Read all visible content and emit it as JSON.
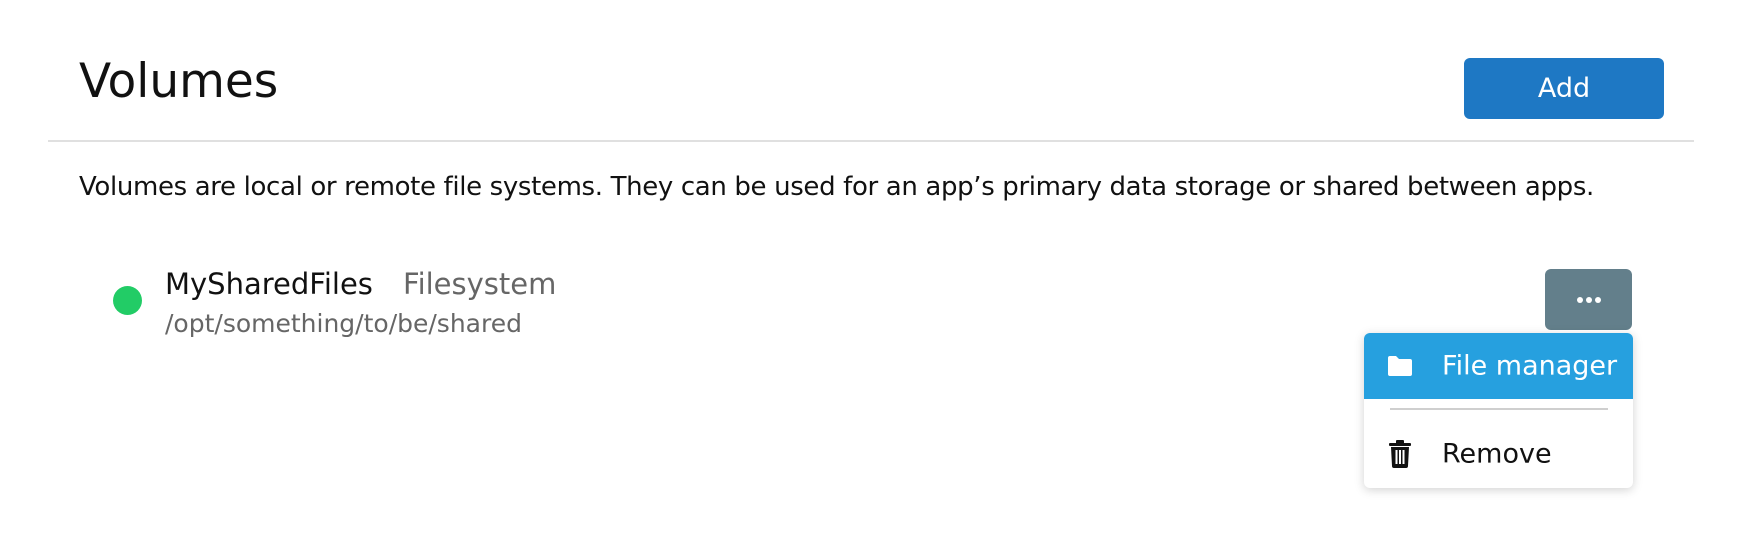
{
  "header": {
    "title": "Volumes",
    "add_label": "Add"
  },
  "description": "Volumes are local or remote file systems. They can be used for an app’s primary data storage or shared between apps.",
  "volumes": [
    {
      "name": "MySharedFiles",
      "type": "Filesystem",
      "path": "/opt/something/to/be/shared",
      "status": "ok",
      "status_color": "#22cc66"
    }
  ],
  "menu": {
    "button_icon": "more-horizontal-icon",
    "items": [
      {
        "label": "File manager",
        "icon": "folder-icon",
        "state": "highlighted"
      },
      {
        "label": "Remove",
        "icon": "trash-icon"
      }
    ]
  },
  "colors": {
    "primary": "#1e78c4",
    "menu_button": "#637f8b",
    "highlight": "#26a0df",
    "status_ok": "#22cc66"
  }
}
